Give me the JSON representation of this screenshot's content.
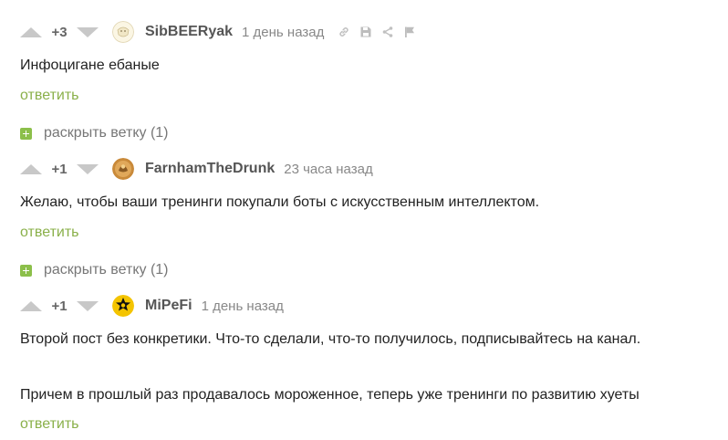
{
  "comments": [
    {
      "rating": "+3",
      "username": "SibBEERyak",
      "time": "1 день назад",
      "text": "Инфоцигане ебаные",
      "reply_label": "ответить"
    },
    {
      "rating": "+1",
      "username": "FarnhamTheDrunk",
      "time": "23 часа назад",
      "text": "Желаю, чтобы ваши тренинги покупали  боты с искусственным интеллектом.",
      "reply_label": "ответить"
    },
    {
      "rating": "+1",
      "username": "MiPeFi",
      "time": "1 день назад",
      "text_lines": [
        "Второй пост без конкретики. Что-то сделали, что-то получилось, подписывайтесь на канал.",
        "Причем в прошлый раз продавалось мороженное, теперь уже тренинги по развитию хуеты"
      ],
      "reply_label": "ответить"
    }
  ],
  "expand_threads": [
    {
      "label": "раскрыть ветку (1)"
    },
    {
      "label": "раскрыть ветку (1)"
    }
  ],
  "colors": {
    "reply_link": "#8ab04a",
    "expand_icon": "#8cbf4a",
    "vote_arrow": "#c8c8c8"
  },
  "icons": [
    "link-icon",
    "save-icon",
    "share-icon",
    "flag-icon"
  ]
}
